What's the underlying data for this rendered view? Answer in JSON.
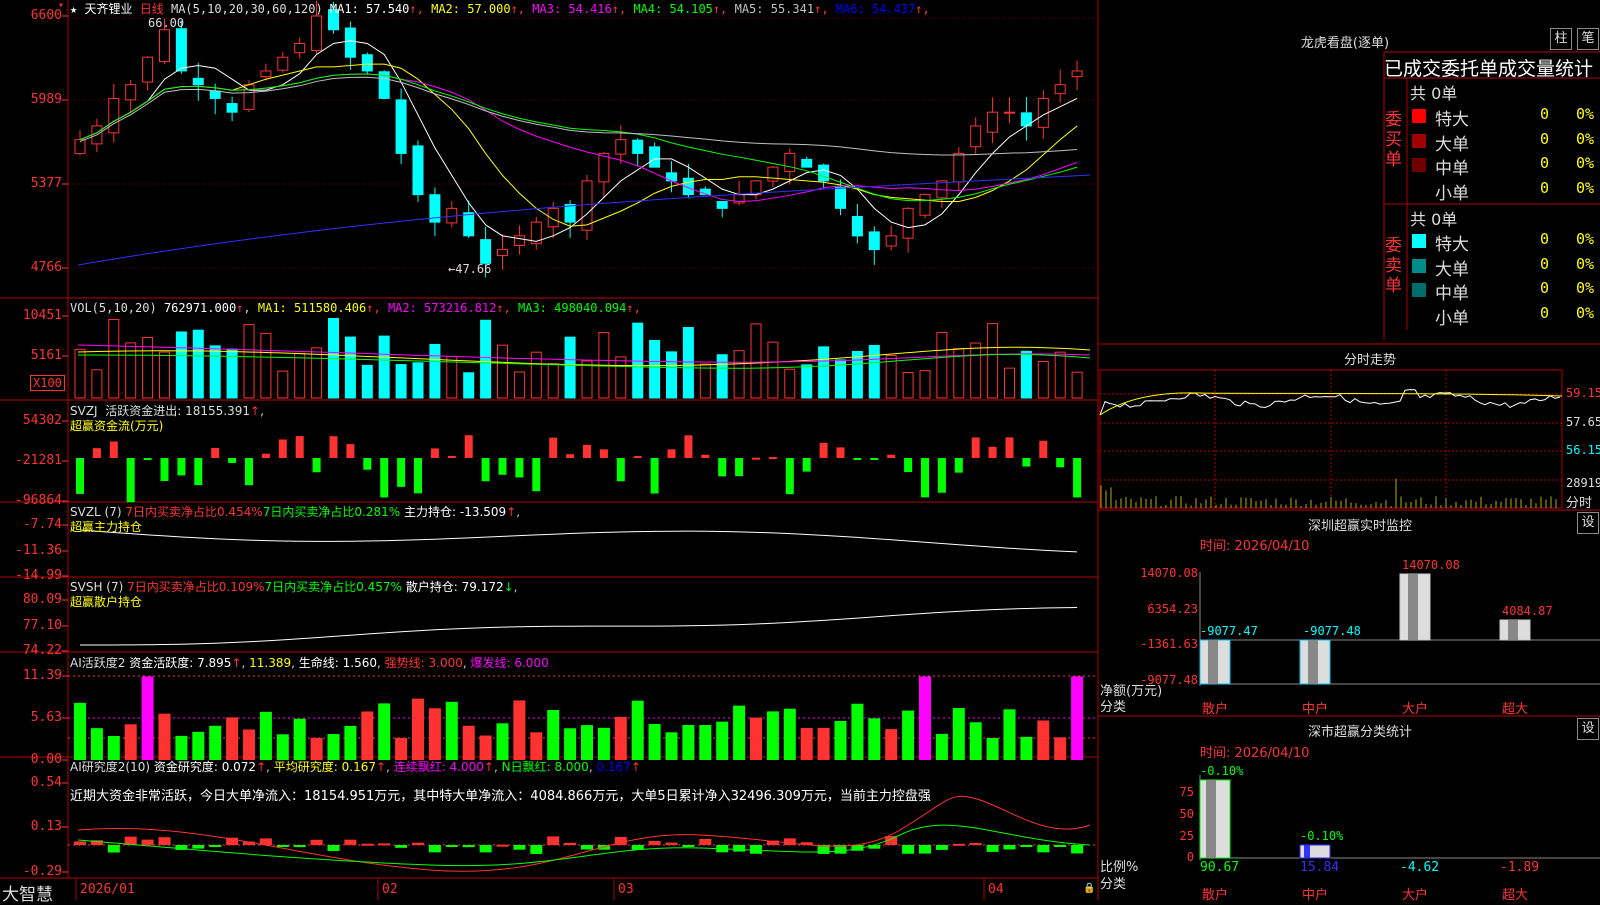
{
  "app": {
    "brand": "大智慧"
  },
  "main_chart": {
    "title_prefix": "★",
    "stock_name": "天齐锂业",
    "period": "日线",
    "ma_label": "MA(5,10,20,30,60,120)",
    "ma": [
      {
        "name": "MA1",
        "value": "57.540",
        "arrow": "↑",
        "color": "#ffffff"
      },
      {
        "name": "MA2",
        "value": "57.000",
        "arrow": "↑",
        "color": "#ffff00"
      },
      {
        "name": "MA3",
        "value": "54.416",
        "arrow": "↑",
        "color": "#ff00ff"
      },
      {
        "name": "MA4",
        "value": "54.105",
        "arrow": "↑",
        "color": "#00ff00"
      },
      {
        "name": "MA5",
        "value": "55.341",
        "arrow": "↑",
        "color": "#c0c0c0"
      },
      {
        "name": "MA6",
        "value": "54.437",
        "arrow": "↑",
        "color": "#0000ff"
      }
    ],
    "yticks": [
      "6600",
      "5989",
      "5377",
      "4766"
    ],
    "high_mark": "66.00",
    "low_mark": "←47.66"
  },
  "vol": {
    "label": "VOL(5,10,20)",
    "value": "762971.000",
    "ma": [
      {
        "name": "MA1",
        "value": "511580.406",
        "color": "#ffff00"
      },
      {
        "name": "MA2",
        "value": "573216.812",
        "color": "#ff00ff"
      },
      {
        "name": "MA3",
        "value": "498040.094",
        "color": "#00ff00"
      }
    ],
    "yticks": [
      "10451",
      "5161"
    ],
    "multiplier": "X100"
  },
  "svzj": {
    "label": "SVZJ",
    "line1": "活跃资金进出: 18155.391",
    "line2": "超赢资金流(万元)",
    "yticks": [
      "54302",
      "-21281",
      "-96864"
    ]
  },
  "svzl": {
    "label": "SVZL (7)",
    "a": "7日内买卖净占比0.454%",
    "b": "7日内买卖净占比0.281%",
    "c": "主力持仓: -13.509",
    "sub": "超赢主力持仓",
    "yticks": [
      "-7.74",
      "-11.36",
      "-14.99"
    ]
  },
  "svsh": {
    "label": "SVSH (7)",
    "a": "7日内买卖净占比0.109%",
    "b": "7日内买卖净占比0.457%",
    "c": "散户持仓: 79.172",
    "sub": "超赢散户持仓",
    "yticks": [
      "80.09",
      "77.10",
      "74.22"
    ]
  },
  "ai_active": {
    "label": "AI活跃度2",
    "a": "资金活跃度: 7.895",
    "b": "11.389",
    "c": "生命线: 1.560",
    "d": "强势线: 3.000",
    "e": "爆发线: 6.000",
    "yticks": [
      "11.39",
      "5.63",
      "0.00"
    ]
  },
  "ai_research": {
    "label": "AI研究度2(10)",
    "a": "资金研究度: 0.072",
    "b": "平均研究度: 0.167",
    "c": "连续飘红: 4.000",
    "d": "N日飘红: 8.000",
    "e": "0.167",
    "commentary": "近期大资金非常活跃，今日大单净流入：18154.951万元，其中特大单净流入：4084.866万元，大单5日累计净入32496.309万元，当前主力控盘强",
    "yticks": [
      "0.54",
      "0.13",
      "-0.29"
    ]
  },
  "xaxis": [
    "2026/01",
    "02",
    "03",
    "04"
  ],
  "longhu": {
    "title": "龙虎看盘(逐单)",
    "btn1": "柱",
    "btn2": "笔",
    "subtitle": "已成交委托单成交量统计",
    "buy_label": "委买单",
    "sell_label": "委卖单",
    "buy_total": "共 0单",
    "sell_total": "共 0单",
    "buy_rows": [
      {
        "name": "特大",
        "count": "0",
        "pct": "0%",
        "color": "#ff0000"
      },
      {
        "name": "大单",
        "count": "0",
        "pct": "0%",
        "color": "#a00000"
      },
      {
        "name": "中单",
        "count": "0",
        "pct": "0%",
        "color": "#700000"
      },
      {
        "name": "小单",
        "count": "0",
        "pct": "0%",
        "color": "#000000"
      }
    ],
    "sell_rows": [
      {
        "name": "特大",
        "count": "0",
        "pct": "0%",
        "color": "#00ffff"
      },
      {
        "name": "大单",
        "count": "0",
        "pct": "0%",
        "color": "#008b8b"
      },
      {
        "name": "中单",
        "count": "0",
        "pct": "0%",
        "color": "#006d6d"
      },
      {
        "name": "小单",
        "count": "0",
        "pct": "0%",
        "color": "#000000"
      }
    ]
  },
  "intraday": {
    "title": "分时走势",
    "yticks": [
      "59.15",
      "57.65",
      "56.15"
    ],
    "vol_tick": "28919",
    "vol_label": "分时"
  },
  "sz_monitor": {
    "title": "深圳超赢实时监控",
    "btn": "设",
    "time": "时间: 2026/04/10",
    "yticks": [
      "14070.08",
      "6354.23",
      "-1361.63",
      "-9077.48"
    ],
    "ylabel": "净额(万元)",
    "xlabel": "分类",
    "categories": [
      "散户",
      "中户",
      "大户",
      "超大"
    ],
    "bar_labels": [
      "-9077.47",
      "-9077.48",
      "14070.08",
      "4084.87"
    ]
  },
  "sz_class": {
    "title": "深市超赢分类统计",
    "btn": "设",
    "time": "时间: 2026/04/10",
    "yticks": [
      "75",
      "50",
      "25",
      "0"
    ],
    "ylabel": "比例%",
    "xlabel": "分类",
    "categories": [
      "散户",
      "中户",
      "大户",
      "超大"
    ],
    "top_labels": [
      "-0.10%",
      "-0.10%"
    ],
    "bottom_values": [
      "90.67",
      "15.84",
      "-4.62",
      "-1.89"
    ]
  },
  "colors": {
    "up": "#ff3232",
    "down": "#00ffff",
    "border": "#b40000",
    "neg_bar": "#00ff00"
  }
}
